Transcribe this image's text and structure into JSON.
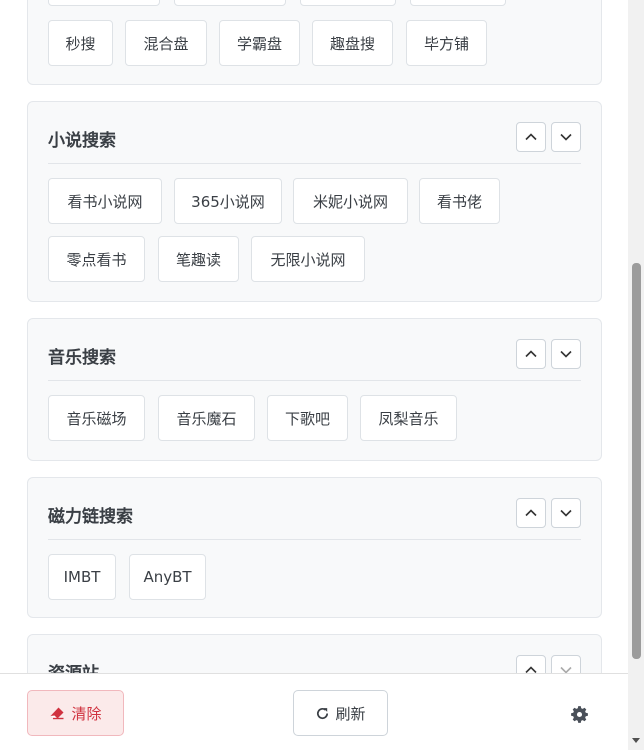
{
  "top_section": {
    "tags": [
      "秒搜",
      "混合盘",
      "学霸盘",
      "趣盘搜",
      "毕方铺"
    ]
  },
  "sections": [
    {
      "title": "小说搜索",
      "tags": [
        "看书小说网",
        "365小说网",
        "米妮小说网",
        "看书佬",
        "零点看书",
        "笔趣读",
        "无限小说网"
      ]
    },
    {
      "title": "音乐搜索",
      "tags": [
        "音乐磁场",
        "音乐魔石",
        "下歌吧",
        "凤梨音乐"
      ]
    },
    {
      "title": "磁力链搜索",
      "tags": [
        "IMBT",
        "AnyBT"
      ]
    },
    {
      "title": "资源站",
      "tags": []
    }
  ],
  "footer": {
    "clear_label": "清除",
    "refresh_label": "刷新",
    "clear_icon": "eraser-icon",
    "refresh_icon": "refresh-icon",
    "settings_icon": "gear-icon"
  },
  "colors": {
    "clear_text": "#d0323f",
    "clear_bg": "#fbeaea",
    "card_bg": "#f8f9fa"
  }
}
